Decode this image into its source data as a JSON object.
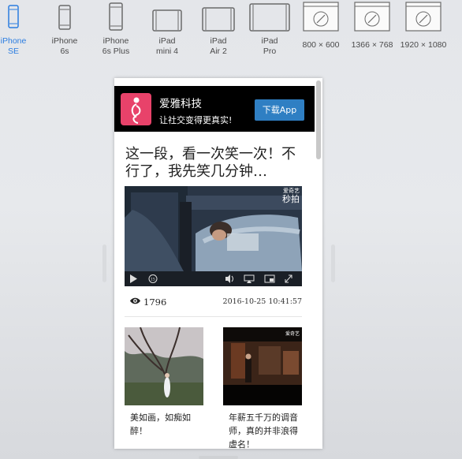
{
  "toolbar": {
    "devices": [
      {
        "label": "iPhone\nSE",
        "active": true
      },
      {
        "label": "iPhone\n6s"
      },
      {
        "label": "iPhone\n6s Plus"
      },
      {
        "label": "iPad\nmini 4"
      },
      {
        "label": "iPad\nAir 2"
      },
      {
        "label": "iPad\nPro"
      },
      {
        "label": "800 × 600"
      },
      {
        "label": "1366 × 768"
      },
      {
        "label": "1920 × 1080"
      }
    ],
    "accent_color": "#2b7de0"
  },
  "app_banner": {
    "name": "爱雅科技",
    "slogan": "让社交变得更真实!",
    "download_label": "下载App",
    "button_color": "#2f7fc3",
    "logo_color": "#e8426a"
  },
  "article": {
    "title": "这一段，看一次笑一次！不行了，我先笑几分钟…",
    "video": {
      "brand_top": "爱奇艺",
      "brand_main": "秒拍"
    },
    "views": "1796",
    "datetime": "2016-10-25 10:41:57"
  },
  "related": [
    {
      "title": "美如画，如痴如醉！"
    },
    {
      "title": "年薪五千万的调音师，真的并非浪得虚名！",
      "tag": "爱奇艺"
    }
  ]
}
